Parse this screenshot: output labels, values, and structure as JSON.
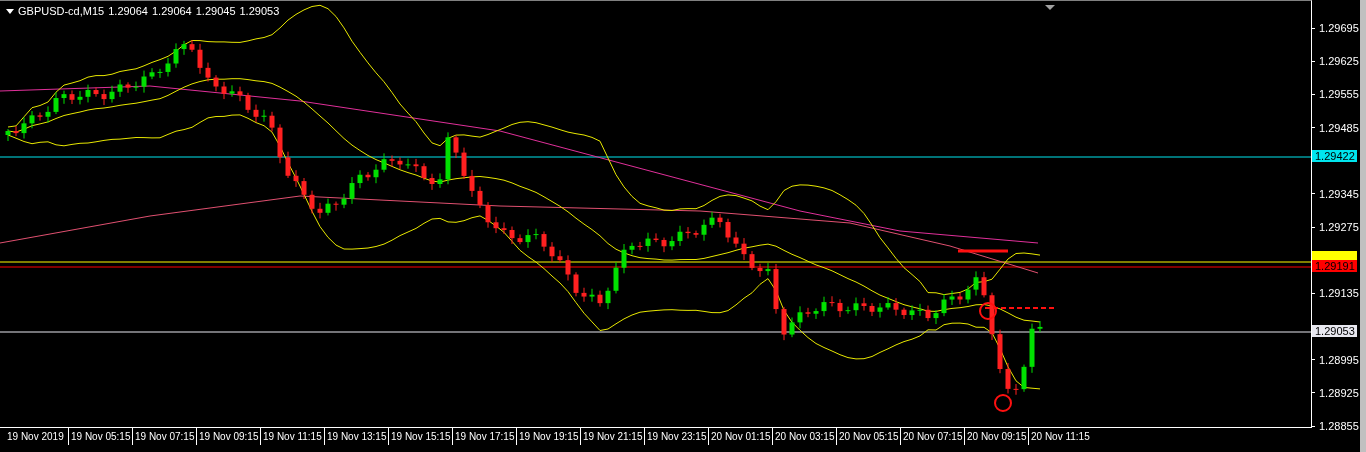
{
  "chart": {
    "symbol": "GBPUSD-cd,M15",
    "quote": [
      "1.29064",
      "1.29064",
      "1.29045",
      "1.29053"
    ]
  },
  "price_axis": {
    "ticks": [
      "1.29695",
      "1.29625",
      "1.29555",
      "1.29485",
      "1.29345",
      "1.29275",
      "1.29135",
      "1.28995",
      "1.28925",
      "1.28855"
    ]
  },
  "levels": [
    {
      "color": "#00e5ee",
      "label": "1.29422"
    },
    {
      "color": "#ffff00"
    },
    {
      "color": "#ff0000",
      "label": "1.29191"
    },
    {
      "color": "#e8e8f0",
      "label": "1.29053"
    }
  ],
  "time_axis": {
    "labels": [
      "19 Nov 2019",
      "19 Nov 05:15",
      "19 Nov 07:15",
      "19 Nov 09:15",
      "19 Nov 11:15",
      "19 Nov 13:15",
      "19 Nov 15:15",
      "19 Nov 17:15",
      "19 Nov 19:15",
      "19 Nov 21:15",
      "19 Nov 23:15",
      "20 Nov 01:15",
      "20 Nov 03:15",
      "20 Nov 05:15",
      "20 Nov 07:15",
      "20 Nov 09:15",
      "20 Nov 11:15"
    ]
  }
}
